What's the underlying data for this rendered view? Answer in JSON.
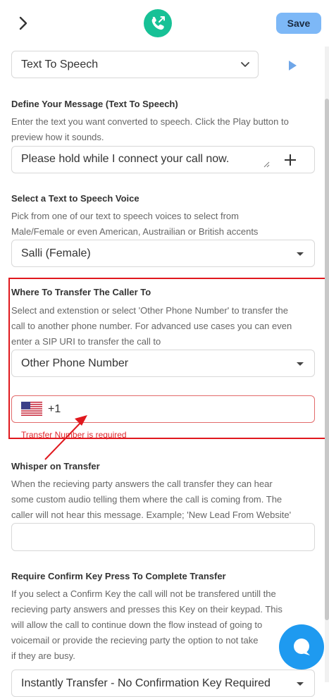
{
  "header": {
    "save_label": "Save"
  },
  "tts_type": {
    "value": "Text To Speech"
  },
  "message": {
    "heading": "Define Your Message (Text To Speech)",
    "desc_lines": [
      "Enter the text you want converted to speech. Click the Play button to",
      "preview how it sounds."
    ],
    "value": "Please hold while I connect your call now."
  },
  "voice": {
    "heading": "Select a Text to Speech Voice",
    "desc_lines": [
      "Pick from one of our text to speech voices to select from",
      "Male/Female or even American, Austrailian or British accents"
    ],
    "value": "Salli (Female)"
  },
  "transfer": {
    "heading": "Where To Transfer The Caller To",
    "desc_lines": [
      "Select and extenstion or select 'Other Phone Number' to transfer the",
      "call to another phone number. For advanced use cases you can even",
      "enter a SIP URI to transfer the call to"
    ],
    "value": "Other Phone Number",
    "dial_code": "+1",
    "error": "Transfer Number is required"
  },
  "whisper": {
    "heading": "Whisper on Transfer",
    "desc_lines": [
      "When the recieving party answers the call transfer they can hear",
      "some custom audio telling them where the call is coming from. The",
      "caller will not hear this message. Example; 'New Lead From Website'"
    ]
  },
  "confirm": {
    "heading": "Require Confirm Key Press To Complete Transfer",
    "desc_lines": [
      "If you select a Confirm Key the call will not be transfered untill the",
      "recieving party answers and presses this Key on their keypad. This",
      "will allow the call to continue down the flow instead of going to",
      "voicemail or provide the recieving party the option to not take",
      "if they are busy."
    ],
    "value": "Instantly Transfer - No Confirmation Key Required"
  },
  "colors": {
    "accent": "#1e9af0",
    "error": "#e0181e",
    "save": "#7db8f7",
    "logo": "#17c196"
  }
}
